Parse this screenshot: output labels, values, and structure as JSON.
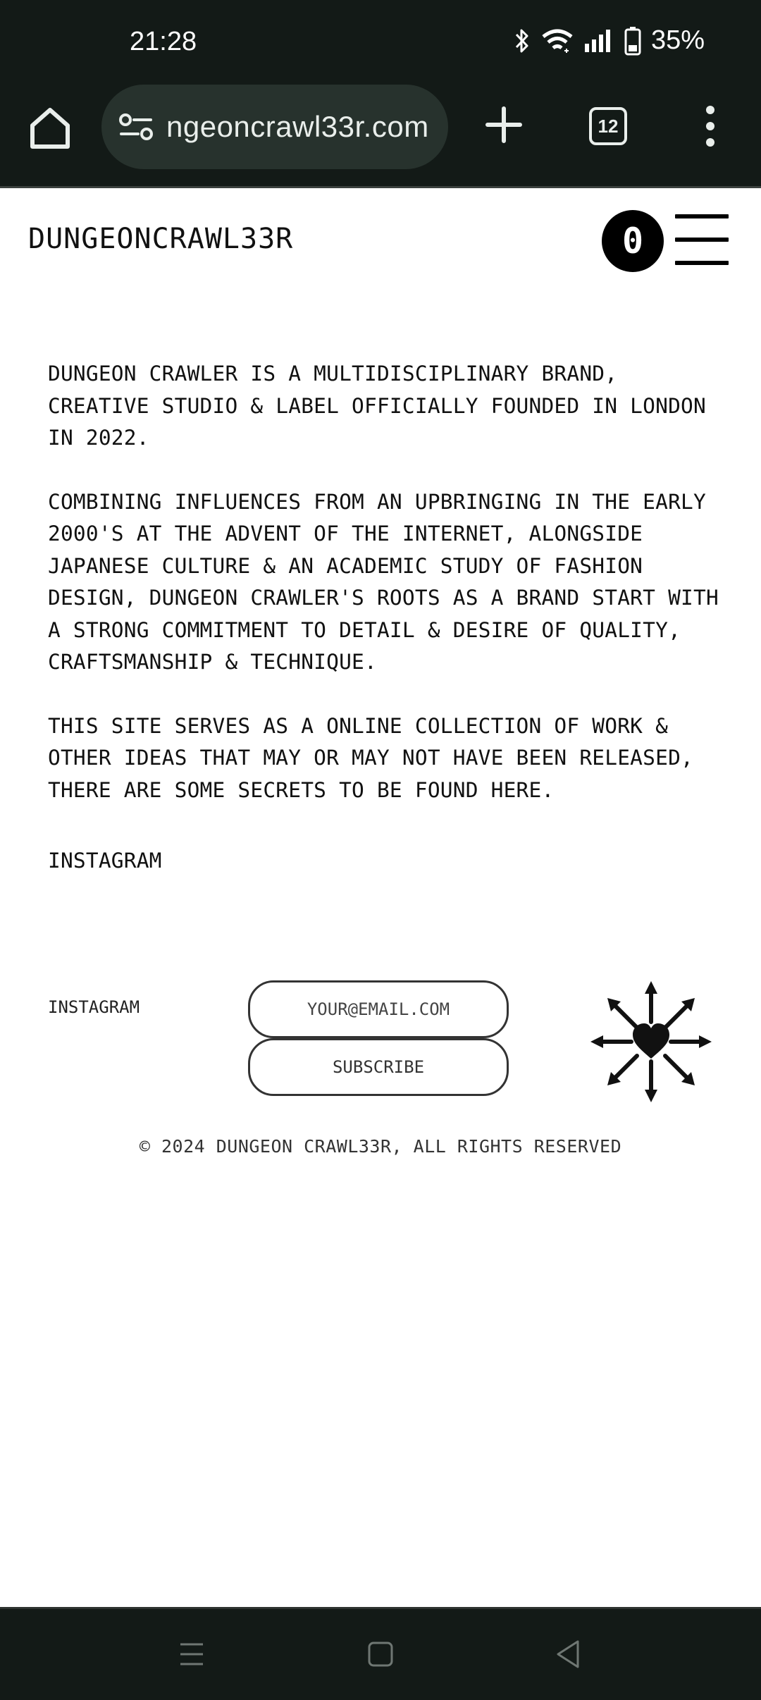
{
  "status_bar": {
    "time": "21:28",
    "battery_percent": "35%",
    "icons": [
      "bluetooth-icon",
      "wifi-icon",
      "signal-icon",
      "battery-icon"
    ]
  },
  "browser": {
    "url": "ngeoncrawl33r.com",
    "tab_count": "12",
    "icons": [
      "home-icon",
      "site-info-icon",
      "new-tab-icon",
      "menu-dots-icon"
    ]
  },
  "site": {
    "logo": "DUNGEONCRAWL33R",
    "zero_button_label": "0",
    "paragraphs": [
      "DUNGEON CRAWLER IS A MULTIDISCIPLINARY BRAND, CREATIVE STUDIO & LABEL OFFICIALLY FOUNDED IN LONDON IN 2022.",
      "COMBINING INFLUENCES FROM AN UPBRINGING IN THE EARLY 2000'S AT THE ADVENT OF THE INTERNET, ALONGSIDE JAPANESE CULTURE & AN ACADEMIC STUDY OF FASHION DESIGN, DUNGEON CRAWLER'S ROOTS AS A BRAND START WITH A STRONG COMMITMENT TO DETAIL & DESIRE OF QUALITY, CRAFTSMANSHIP & TECHNIQUE.",
      "THIS SITE SERVES AS A ONLINE COLLECTION OF WORK & OTHER IDEAS THAT MAY OR MAY NOT HAVE BEEN RELEASED, THERE ARE SOME SECRETS TO BE FOUND HERE."
    ],
    "instagram_link": "INSTAGRAM"
  },
  "footer": {
    "instagram_link": "INSTAGRAM",
    "email_placeholder": "YOUR@EMAIL.COM",
    "email_value": "",
    "subscribe_label": "SUBSCRIBE",
    "copyright": "© 2024 DUNGEON CRAWL33R, ALL RIGHTS RESERVED"
  },
  "colors": {
    "system_bar": "#131a17",
    "url_pill": "#27322d",
    "page_background": "#ffffff",
    "text": "#111111"
  }
}
